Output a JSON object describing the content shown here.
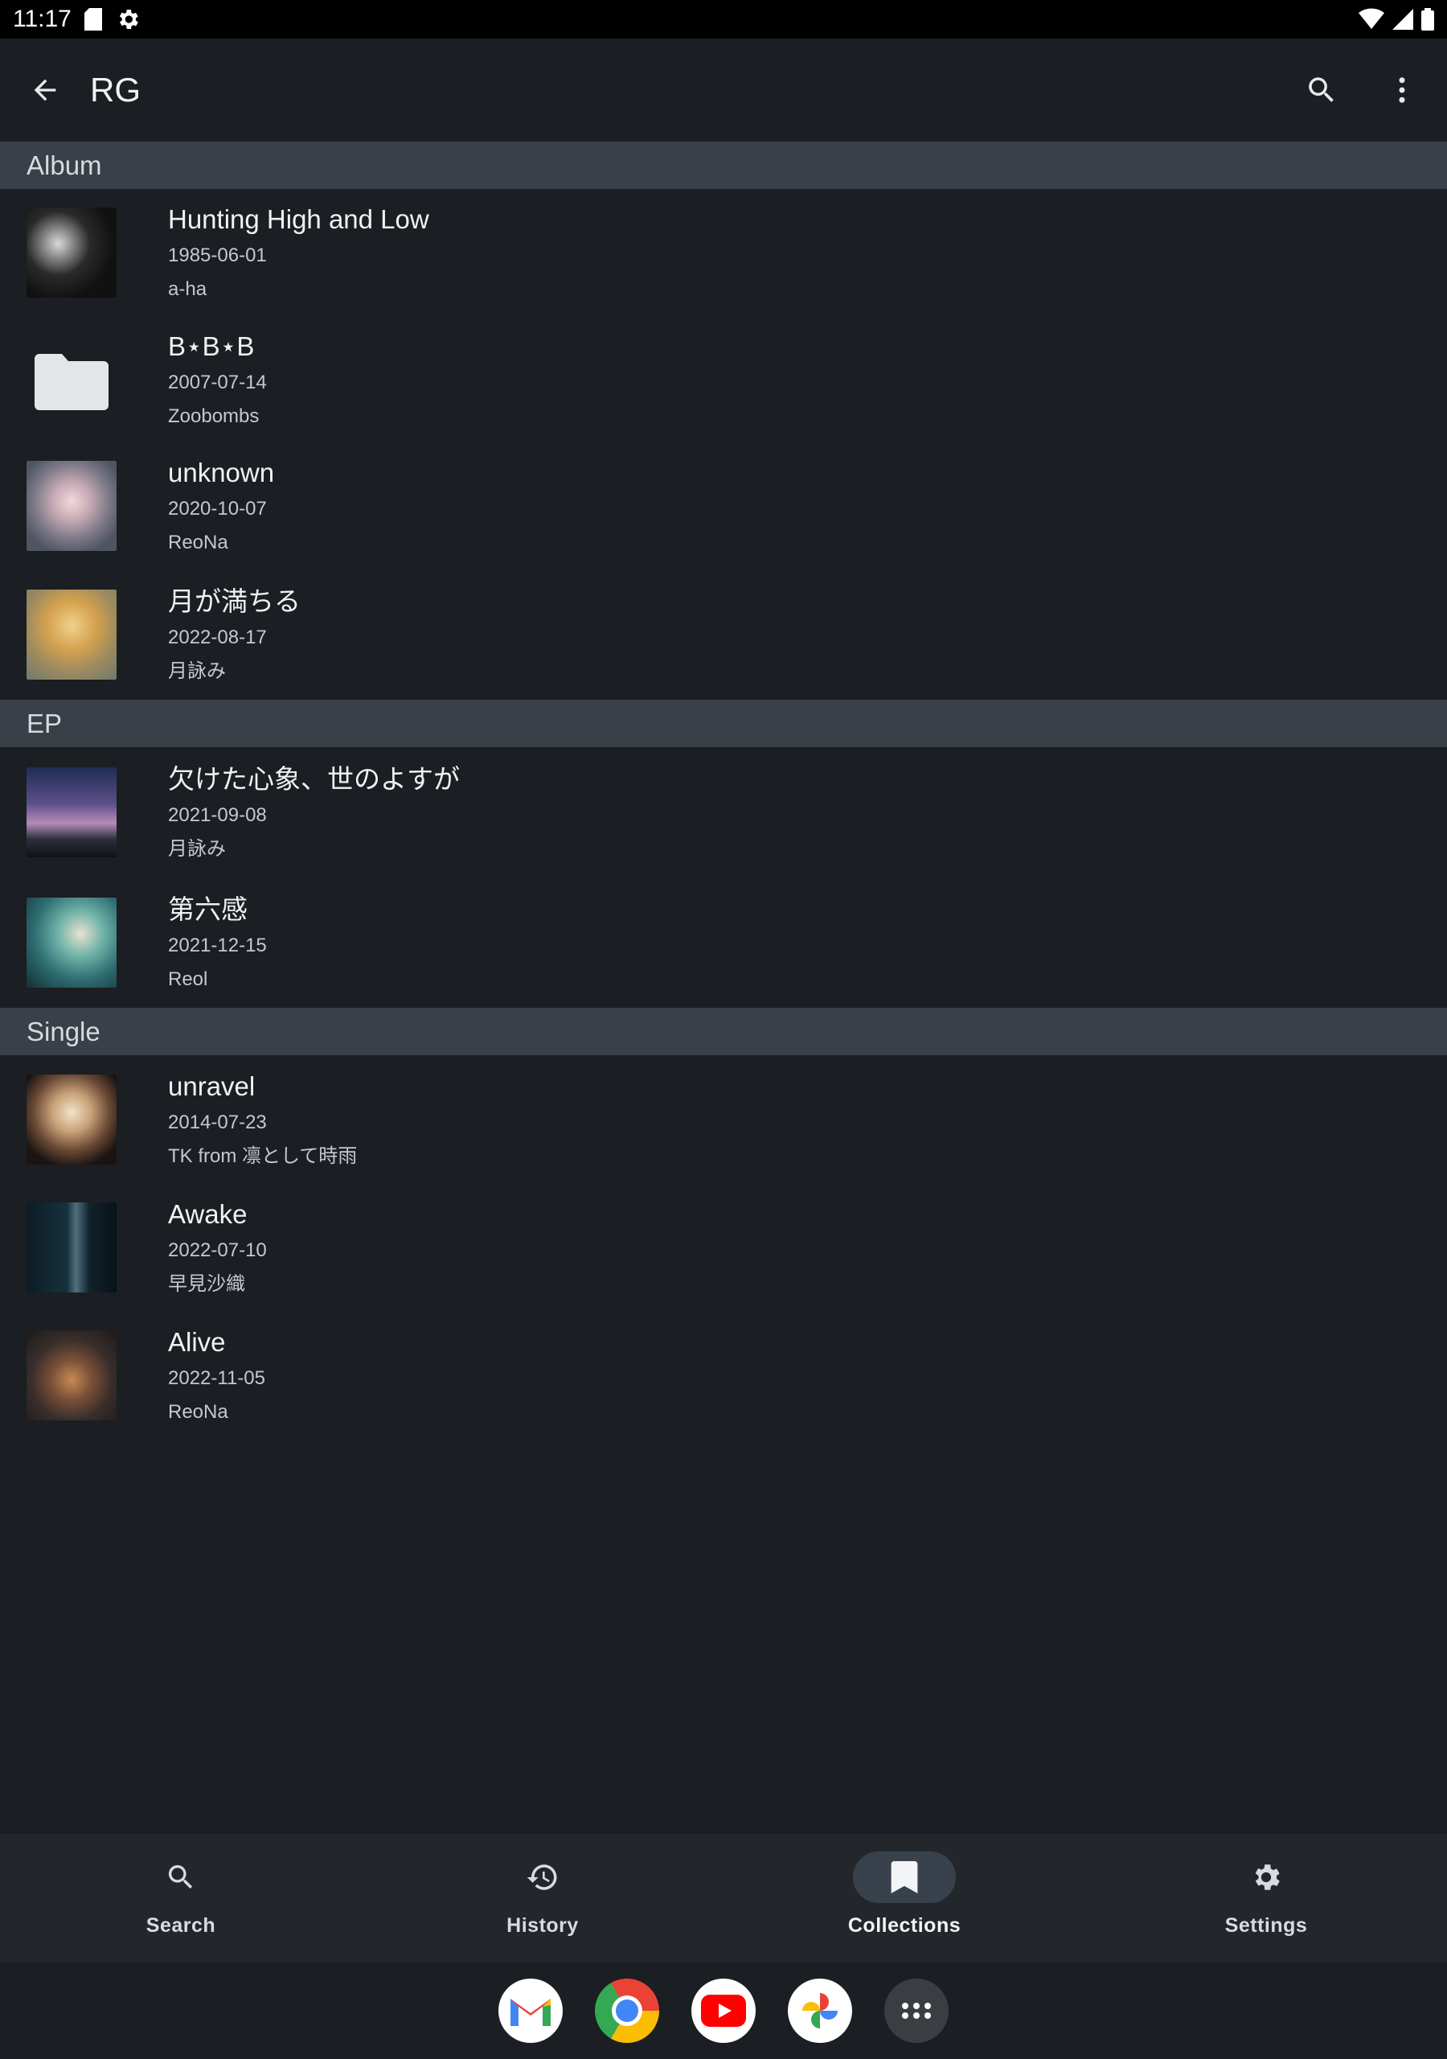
{
  "status_bar": {
    "time": "11:17"
  },
  "toolbar": {
    "title": "RG"
  },
  "sections": [
    {
      "header": "Album",
      "items": [
        {
          "title": "Hunting High and Low",
          "date": "1985-06-01",
          "artist": "a-ha"
        },
        {
          "title": "B⋆B⋆B",
          "date": "2007-07-14",
          "artist": "Zoobombs"
        },
        {
          "title": "unknown",
          "date": "2020-10-07",
          "artist": "ReoNa"
        },
        {
          "title": "月が満ちる",
          "date": "2022-08-17",
          "artist": "月詠み"
        }
      ]
    },
    {
      "header": "EP",
      "items": [
        {
          "title": "欠けた心象、世のよすが",
          "date": "2021-09-08",
          "artist": "月詠み"
        },
        {
          "title": "第六感",
          "date": "2021-12-15",
          "artist": "Reol"
        }
      ]
    },
    {
      "header": "Single",
      "items": [
        {
          "title": "unravel",
          "date": "2014-07-23",
          "artist": "TK from 凛として時雨"
        },
        {
          "title": "Awake",
          "date": "2022-07-10",
          "artist": "早見沙織"
        },
        {
          "title": "Alive",
          "date": "2022-11-05",
          "artist": "ReoNa"
        }
      ]
    }
  ],
  "bottom_nav": {
    "items": [
      {
        "label": "Search",
        "icon": "search-icon"
      },
      {
        "label": "History",
        "icon": "history-icon"
      },
      {
        "label": "Collections",
        "icon": "bookmark-icon",
        "active": true
      },
      {
        "label": "Settings",
        "icon": "gear-icon"
      }
    ]
  },
  "dock": {
    "apps": [
      "gmail-icon",
      "chrome-icon",
      "youtube-icon",
      "photos-icon",
      "app-drawer-icon"
    ]
  },
  "colors": {
    "background": "#1b1e22",
    "section_header": "#3a4048",
    "nav_active_pill": "#39424c"
  }
}
